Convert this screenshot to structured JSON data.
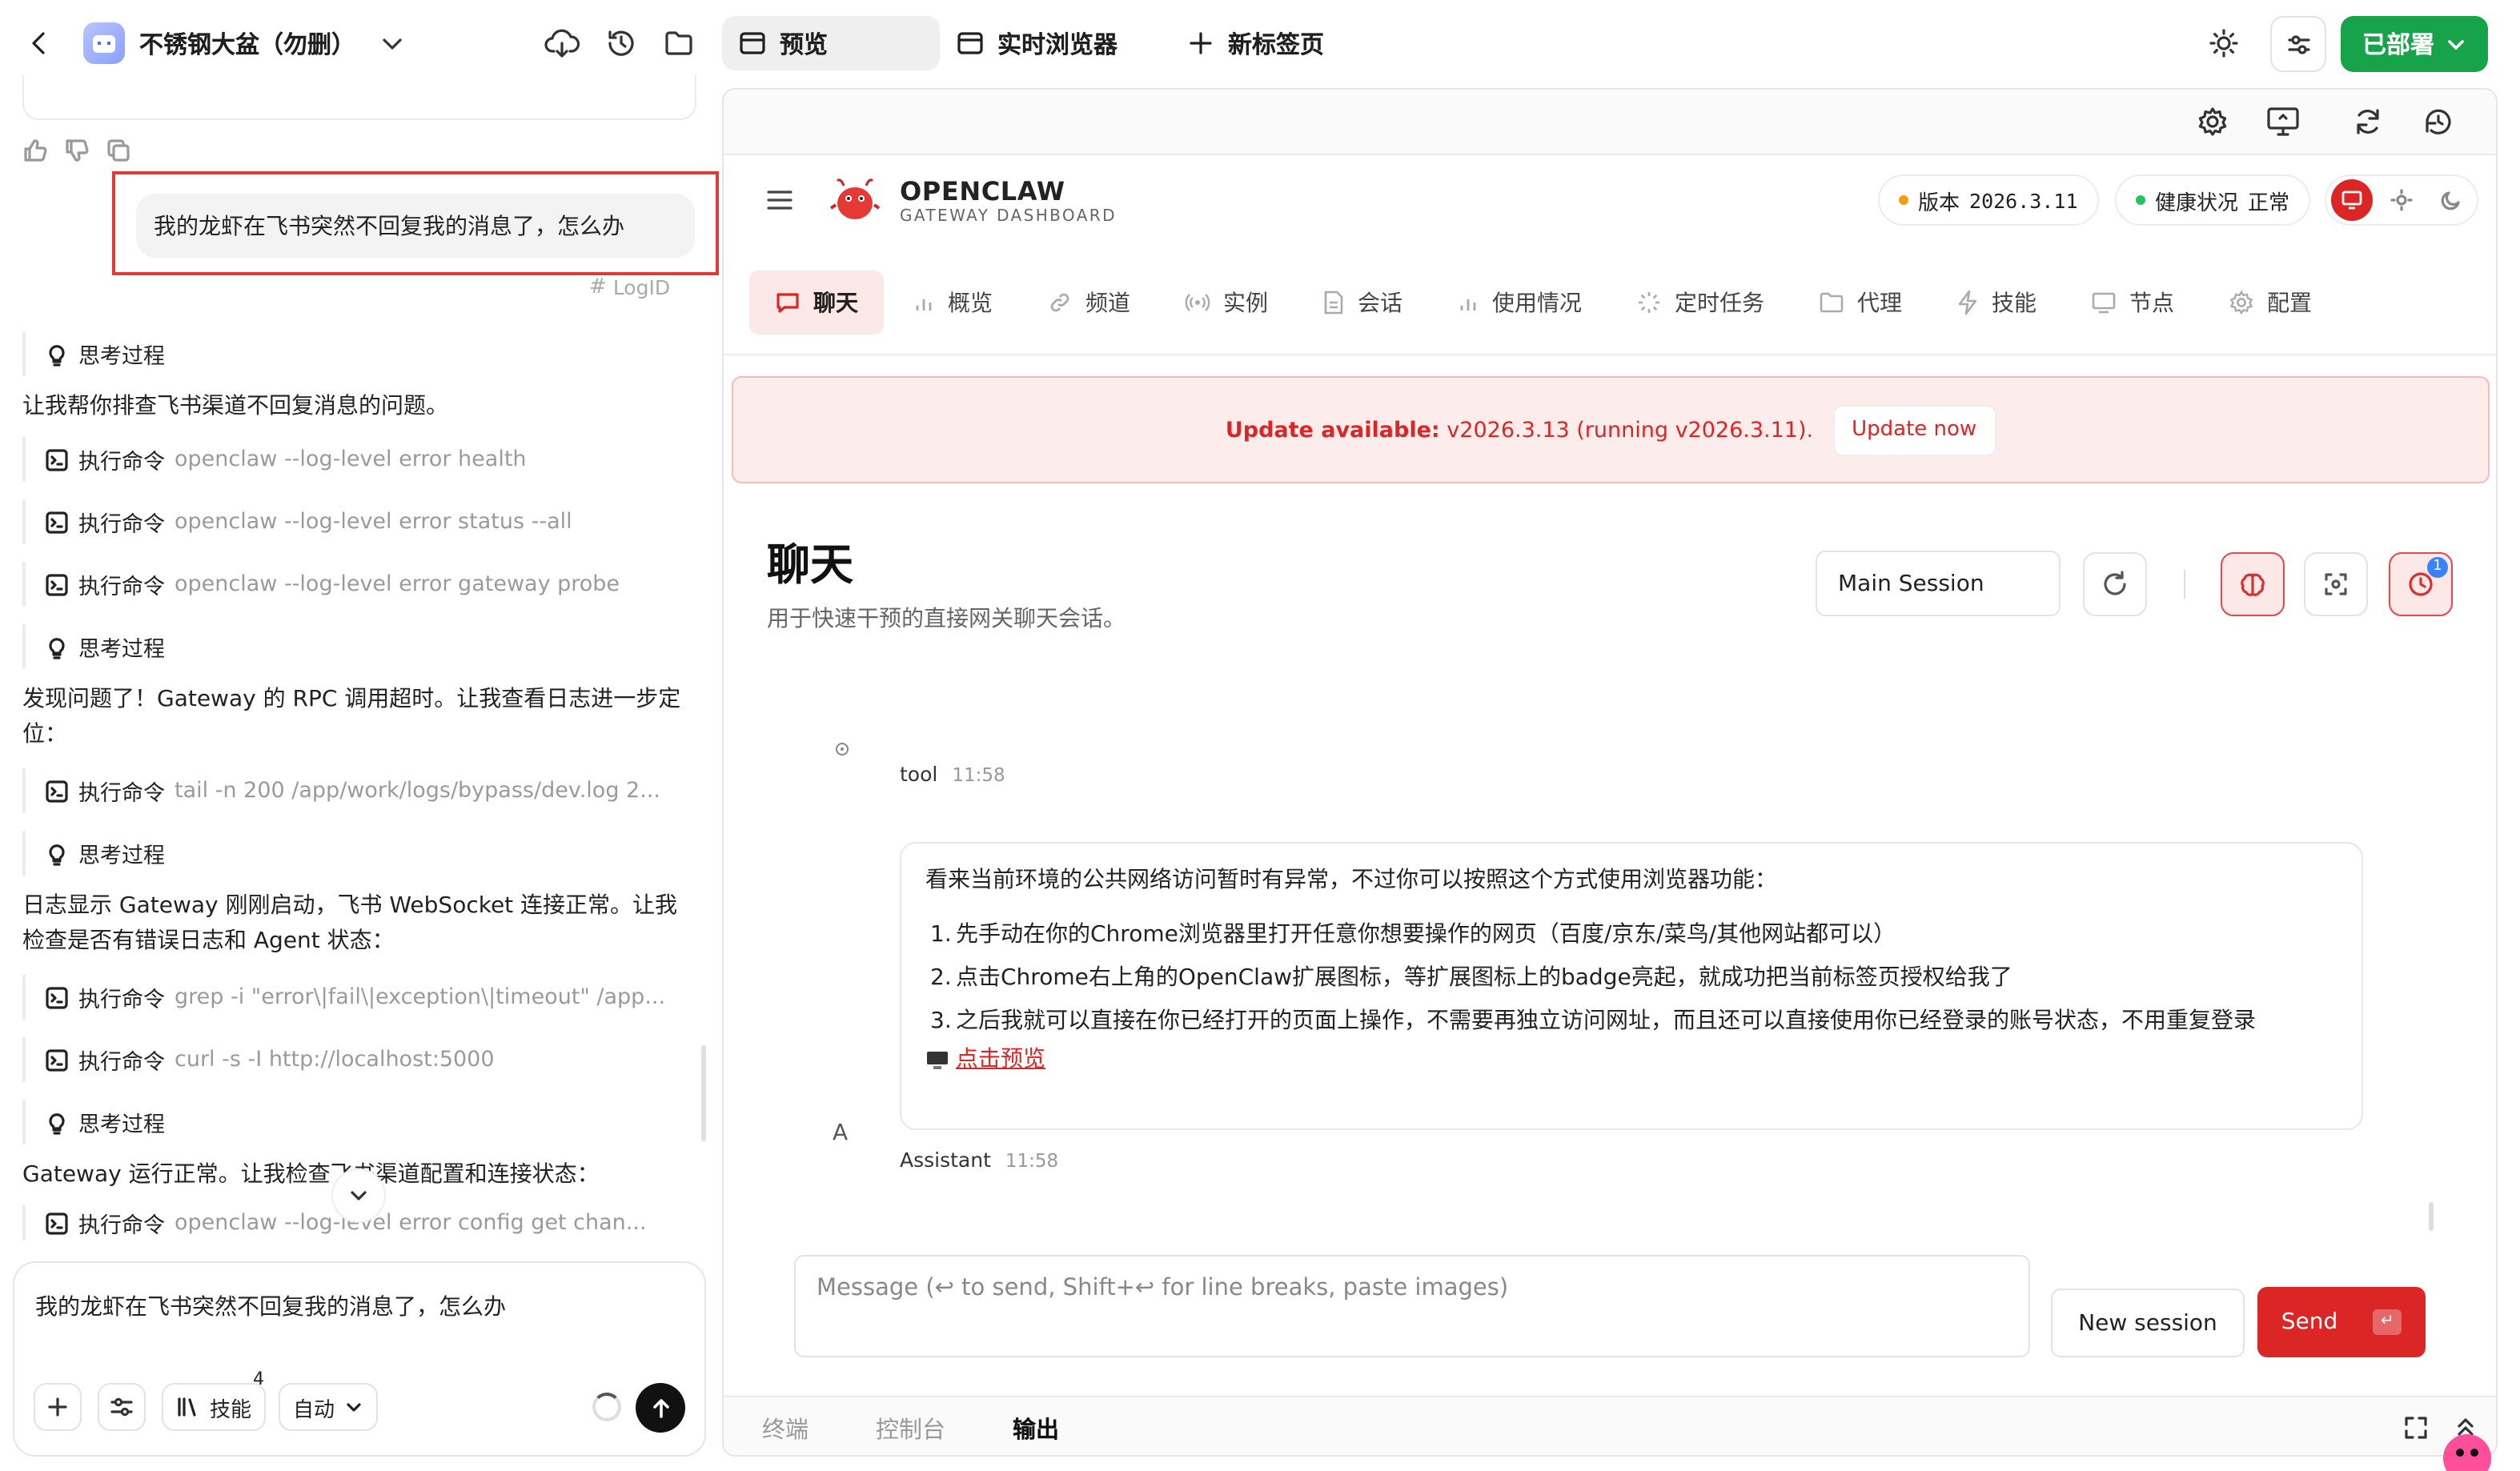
{
  "topbar": {
    "project_title": "不锈钢大盆（勿删）",
    "tabs": [
      {
        "label": "预览",
        "active": true
      },
      {
        "label": "实时浏览器",
        "active": false
      },
      {
        "label": "新标签页",
        "active": false
      }
    ],
    "deploy_label": "已部署"
  },
  "left": {
    "user_message": "我的龙虾在飞书突然不回复我的消息了，怎么办",
    "log_id": "LogID",
    "steps": [
      {
        "kind": "think",
        "label": "思考过程"
      },
      {
        "kind": "text",
        "text": "让我帮你排查飞书渠道不回复消息的问题。"
      },
      {
        "kind": "cmd",
        "label": "执行命令",
        "cmd": "openclaw --log-level error health"
      },
      {
        "kind": "cmd",
        "label": "执行命令",
        "cmd": "openclaw --log-level error status --all"
      },
      {
        "kind": "cmd",
        "label": "执行命令",
        "cmd": "openclaw --log-level error gateway probe"
      },
      {
        "kind": "think",
        "label": "思考过程"
      },
      {
        "kind": "text",
        "text": "发现问题了！Gateway 的 RPC 调用超时。让我查看日志进一步定位："
      },
      {
        "kind": "cmd",
        "label": "执行命令",
        "cmd": "tail -n 200 /app/work/logs/bypass/dev.log 2..."
      },
      {
        "kind": "think",
        "label": "思考过程"
      },
      {
        "kind": "text",
        "text": "日志显示 Gateway 刚刚启动，飞书 WebSocket 连接正常。让我检查是否有错误日志和 Agent 状态："
      },
      {
        "kind": "cmd",
        "label": "执行命令",
        "cmd": "grep -i \"error\\|fail\\|exception\\|timeout\" /app..."
      },
      {
        "kind": "cmd",
        "label": "执行命令",
        "cmd": "curl -s -I http://localhost:5000"
      },
      {
        "kind": "think",
        "label": "思考过程"
      },
      {
        "kind": "text",
        "text": "Gateway 运行正常。让我检查飞书渠道配置和连接状态："
      },
      {
        "kind": "cmd",
        "label": "执行命令",
        "cmd": "openclaw --log-level error config get chan..."
      }
    ],
    "composer_text": "我的龙虾在飞书突然不回复我的消息了，怎么办",
    "skills_label": "技能",
    "skills_count": "4",
    "mode_label": "自动"
  },
  "right": {
    "brand_name": "OPENCLAW",
    "brand_sub": "GATEWAY DASHBOARD",
    "version_label": "版本",
    "version_value": "2026.3.11",
    "health_label": "健康状况",
    "health_value": "正常",
    "nav": [
      "聊天",
      "概览",
      "频道",
      "实例",
      "会话",
      "使用情况",
      "定时任务",
      "代理",
      "技能",
      "节点",
      "配置"
    ],
    "update_banner": {
      "prefix": "Update available:",
      "text": " v2026.3.13 (running v2026.3.11).",
      "button": "Update now"
    },
    "page_title": "聊天",
    "page_subtitle": "用于快速干预的直接网关聊天会话。",
    "session_select": "Main Session",
    "badge_count": "1",
    "tool_sender": "tool",
    "tool_time": "11:58",
    "assistant_intro": "看来当前环境的公共网络访问暂时有异常，不过你可以按照这个方式使用浏览器功能：",
    "assistant_items": [
      "先手动在你的Chrome浏览器里打开任意你想要操作的网页（百度/京东/菜鸟/其他网站都可以）",
      "点击Chrome右上角的OpenClaw扩展图标，等扩展图标上的badge亮起，就成功把当前标签页授权给我了",
      "之后我就可以直接在你已经打开的页面上操作，不需要再独立访问网址，而且还可以直接使用你已经登录的账号状态，不用重复登录"
    ],
    "preview_link": "点击预览",
    "assistant_avatar": "A",
    "assistant_sender": "Assistant",
    "assistant_time": "11:58",
    "message_placeholder": "Message (↩ to send, Shift+↩ for line breaks, paste images)",
    "new_session": "New session",
    "send": "Send",
    "bottom_tabs": [
      "终端",
      "控制台",
      "输出"
    ]
  },
  "colors": {
    "accent_green": "#16a34a",
    "accent_red": "#dc2626",
    "highlight_box": "#e53935"
  }
}
